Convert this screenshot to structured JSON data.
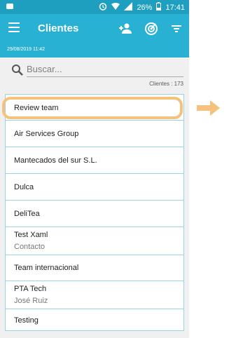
{
  "status": {
    "time": "17:41",
    "battery": "26%"
  },
  "app": {
    "title": "Clientes",
    "date": "29/08/2019 11:42"
  },
  "search": {
    "placeholder": "Buscar..."
  },
  "count_label": "Clientes : 173",
  "clients": [
    {
      "name": "Review team",
      "sub": ""
    },
    {
      "name": "Air Services Group",
      "sub": ""
    },
    {
      "name": "Mantecados del sur S.L.",
      "sub": ""
    },
    {
      "name": "Dulca",
      "sub": ""
    },
    {
      "name": "DeliTea",
      "sub": ""
    },
    {
      "name": "Test Xaml",
      "sub": "Contacto"
    },
    {
      "name": "Team internacional",
      "sub": ""
    },
    {
      "name": "PTA Tech",
      "sub": "José Ruiz"
    },
    {
      "name": "Testing",
      "sub": ""
    }
  ],
  "colors": {
    "header": "#29b1d3",
    "status": "#1f9fbf",
    "highlight": "#f4c27d",
    "border": "#9ad3e6"
  }
}
